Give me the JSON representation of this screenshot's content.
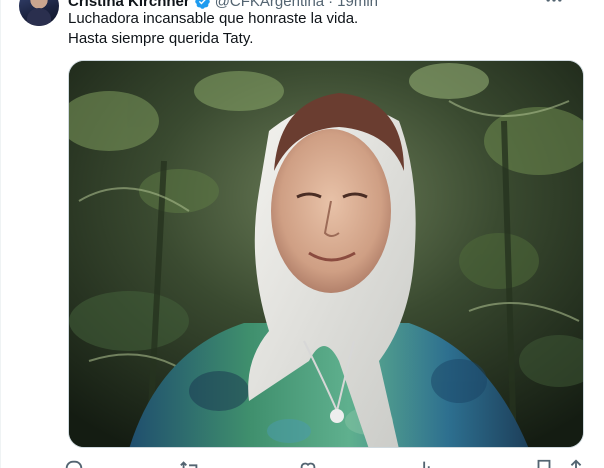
{
  "author": {
    "name": "Cristina Kirchner",
    "handle": "@CFKArgentina",
    "separator": "·",
    "time": "19min"
  },
  "tweet": {
    "lines": [
      "Luchadora incansable que honraste la vida.",
      "Hasta siempre querida Taty."
    ]
  },
  "photo": {
    "subject": "elderly-woman-with-white-headscarf"
  },
  "icons": {
    "verified": "verified-badge-icon",
    "more": "more-icon",
    "reply": "reply-icon",
    "retweet": "retweet-icon",
    "like": "like-icon",
    "views": "views-icon",
    "bookmark": "bookmark-icon",
    "share": "share-icon"
  },
  "colors": {
    "text": "#0f1419",
    "secondary": "#536471",
    "verified": "#1d9bf0",
    "border": "#cfd9de"
  }
}
